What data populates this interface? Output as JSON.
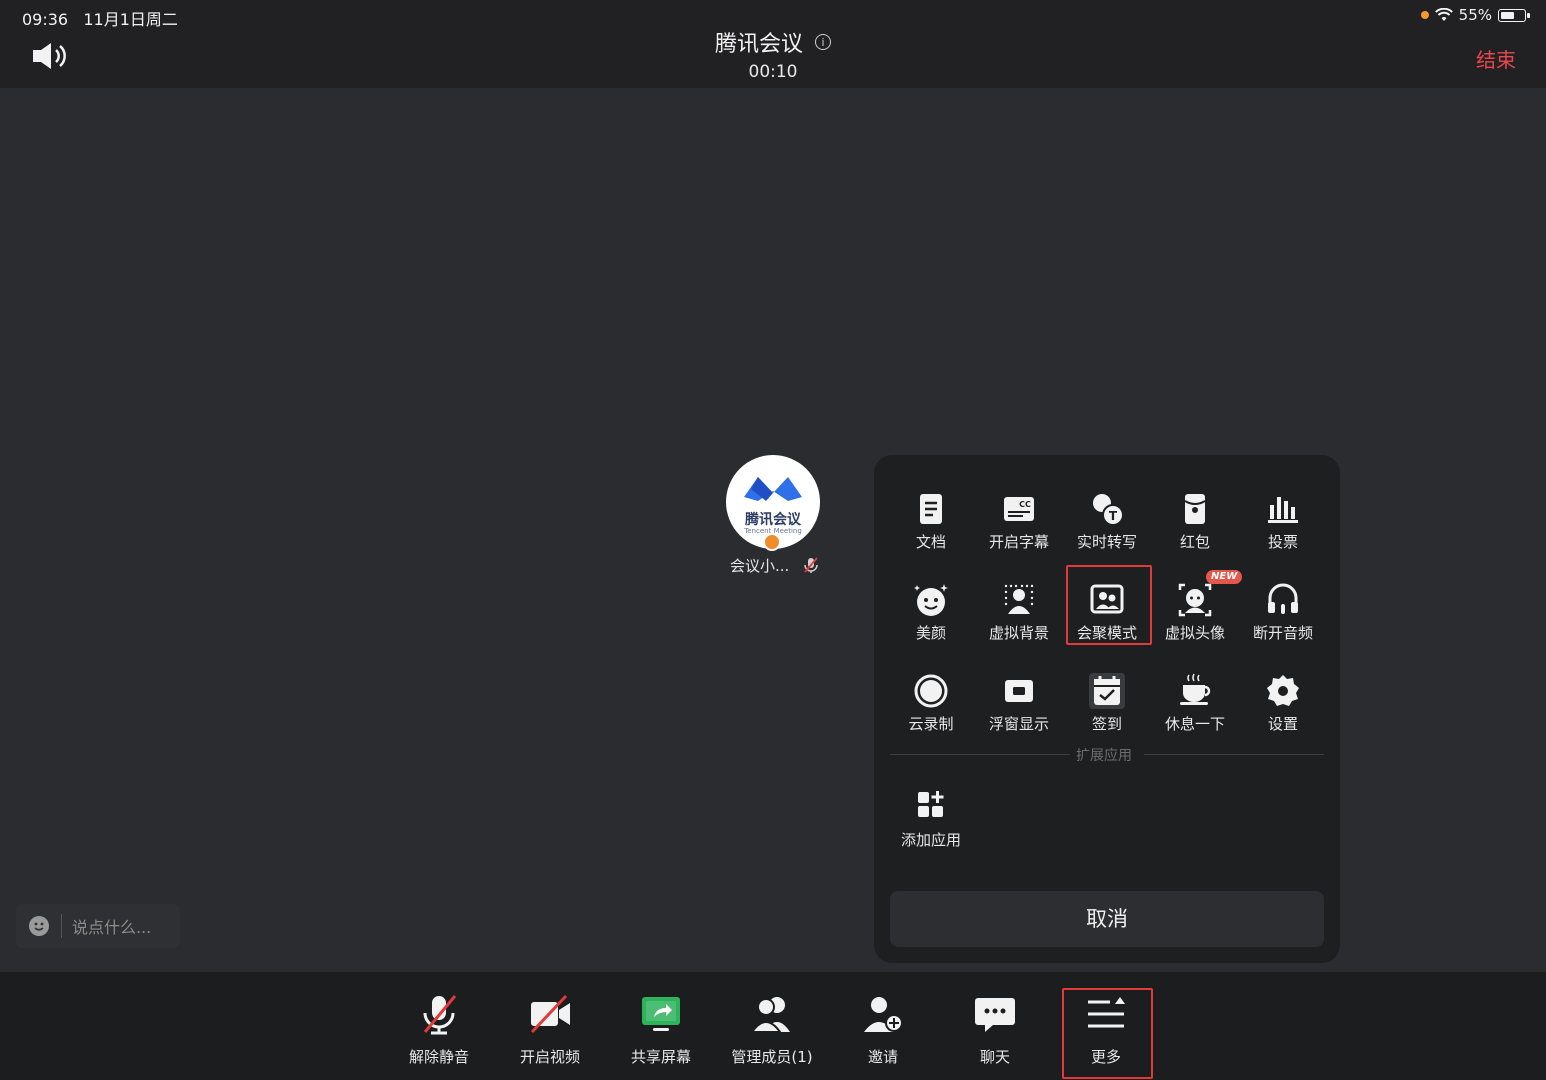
{
  "status_bar": {
    "time": "09:36",
    "date": "11月1日周二",
    "battery": "55%"
  },
  "header": {
    "title": "腾讯会议",
    "timer": "00:10",
    "end_label": "结束"
  },
  "participant": {
    "logo_text": "腾讯会议",
    "logo_sub": "Tencent Meeting",
    "name": "会议小..."
  },
  "chat": {
    "placeholder": "说点什么..."
  },
  "more_panel": {
    "row1": [
      {
        "label": "文档",
        "icon": "document-icon"
      },
      {
        "label": "开启字幕",
        "icon": "captions-icon"
      },
      {
        "label": "实时转写",
        "icon": "transcribe-icon"
      },
      {
        "label": "红包",
        "icon": "red-packet-icon"
      },
      {
        "label": "投票",
        "icon": "vote-icon"
      }
    ],
    "row2": [
      {
        "label": "美颜",
        "icon": "beauty-icon"
      },
      {
        "label": "虚拟背景",
        "icon": "virtual-background-icon"
      },
      {
        "label": "会聚模式",
        "icon": "together-mode-icon"
      },
      {
        "label": "虚拟头像",
        "icon": "virtual-avatar-icon",
        "badge": "NEW"
      },
      {
        "label": "断开音频",
        "icon": "headphones-icon"
      }
    ],
    "row3": [
      {
        "label": "云录制",
        "icon": "cloud-record-icon"
      },
      {
        "label": "浮窗显示",
        "icon": "floating-window-icon"
      },
      {
        "label": "签到",
        "icon": "check-in-icon"
      },
      {
        "label": "休息一下",
        "icon": "coffee-icon"
      },
      {
        "label": "设置",
        "icon": "settings-icon"
      }
    ],
    "section_label": "扩展应用",
    "add_app_label": "添加应用",
    "cancel_label": "取消"
  },
  "toolbar": {
    "unmute": "解除静音",
    "start_video": "开启视频",
    "share_screen": "共享屏幕",
    "manage_members": "管理成员(1)",
    "invite": "邀请",
    "chat": "聊天",
    "more": "更多"
  },
  "colors": {
    "end": "#e8484c",
    "highlight": "#e03a3a",
    "share_green": "#2db35b",
    "new_badge": "#e6574b"
  }
}
